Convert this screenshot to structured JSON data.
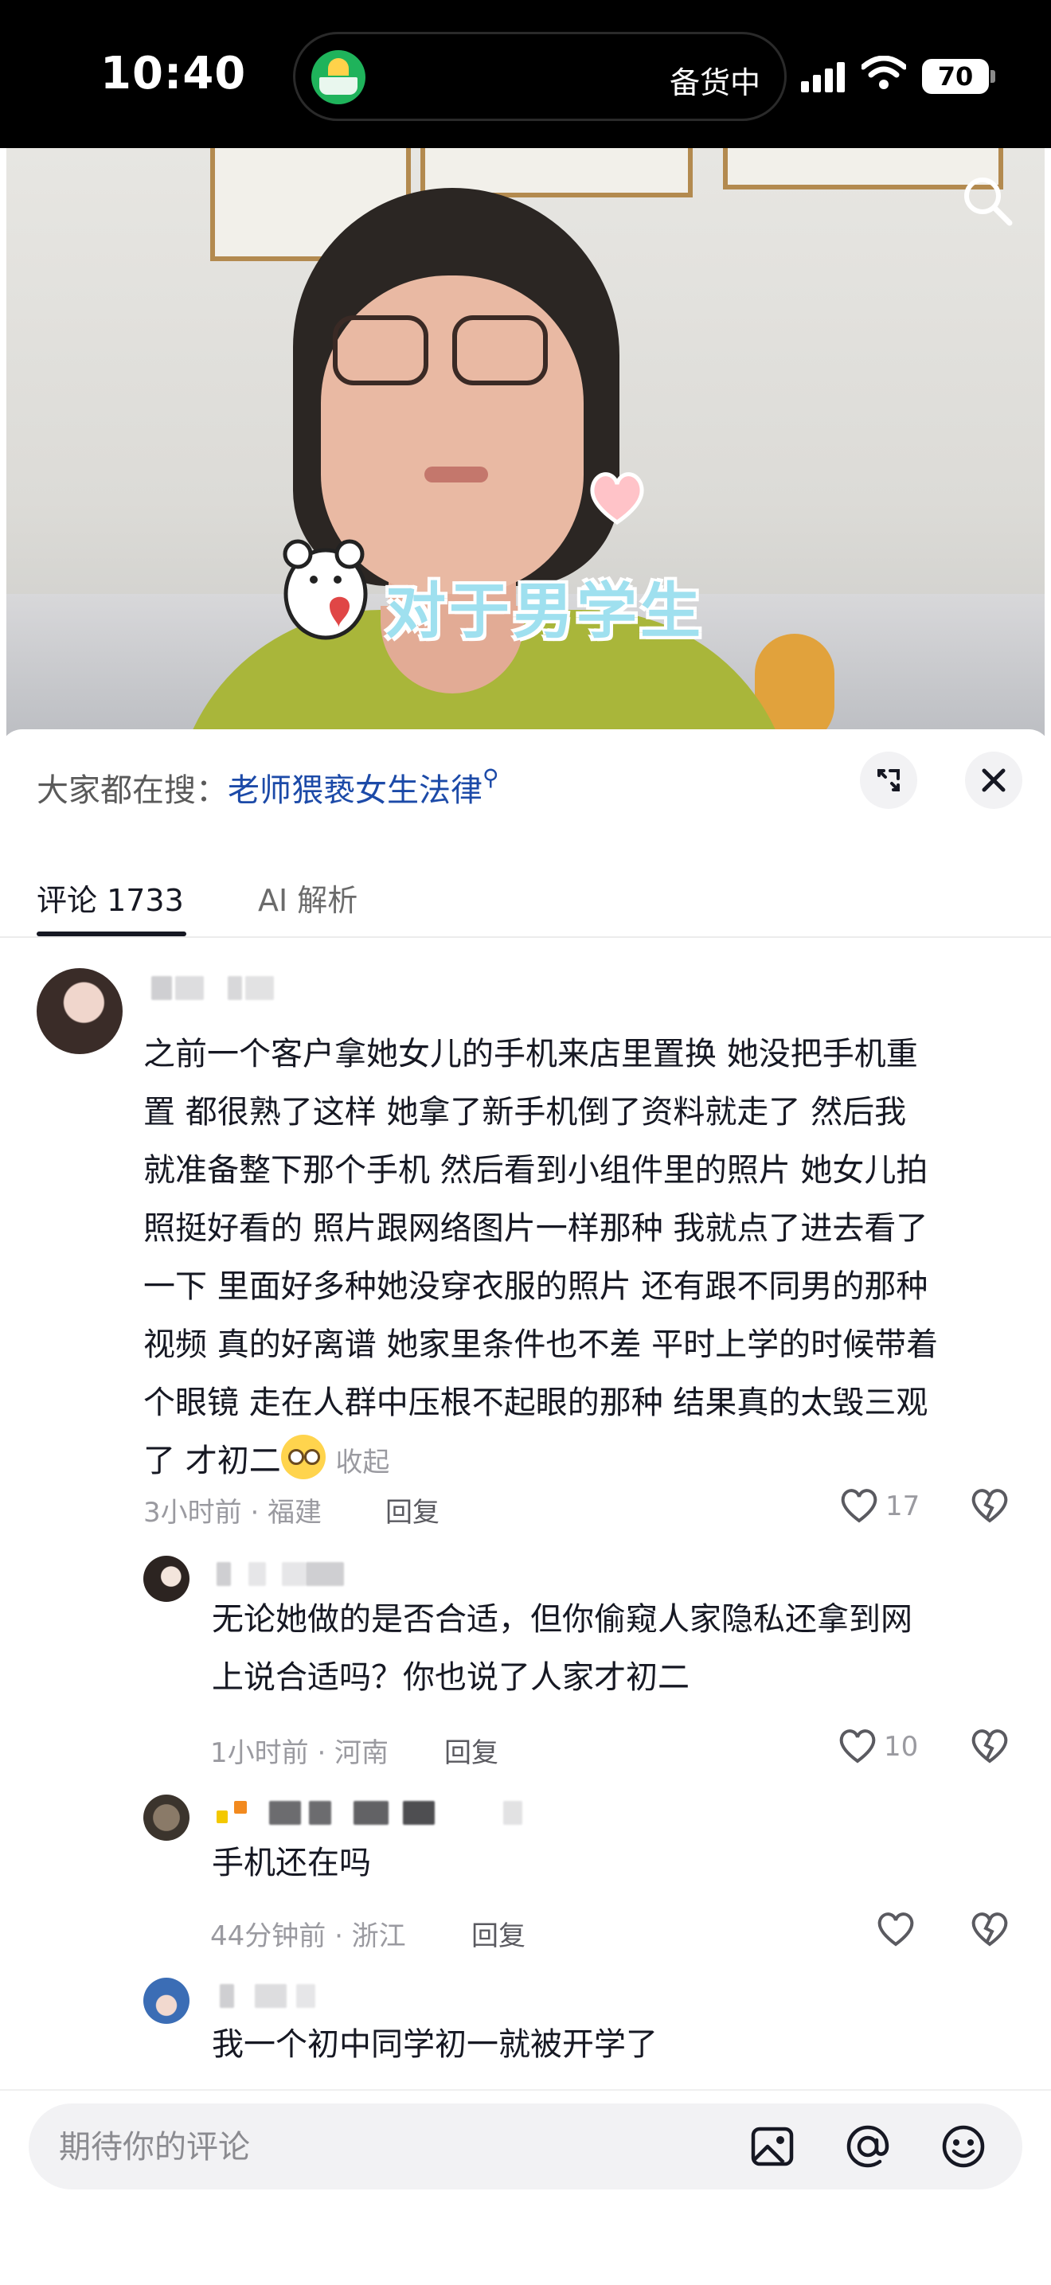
{
  "status_bar": {
    "time": "10:40",
    "island_text": "备货中",
    "battery": "70"
  },
  "video": {
    "sticker_text": "对于男学生"
  },
  "hot_search": {
    "prefix": "大家都在搜：",
    "keyword": "老师猥亵女生法律"
  },
  "tabs": [
    {
      "label": "评论 1733",
      "active": true
    },
    {
      "label": "AI 解析",
      "active": false
    }
  ],
  "comments": [
    {
      "lines": [
        "之前一个客户拿她女儿的手机来店里置换 她没把手机重",
        "置 都很熟了这样 她拿了新手机倒了资料就走了  然后我",
        "就准备整下那个手机 然后看到小组件里的照片 她女儿拍",
        "照挺好看的 照片跟网络图片一样那种 我就点了进去看了",
        "一下 里面好多种她没穿衣服的照片 还有跟不同男的那种",
        "视频 真的好离谱 她家里条件也不差 平时上学的时候带着",
        "个眼镜 走在人群中压根不起眼的那种 结果真的太毁三观",
        "了 才初二"
      ],
      "collapse": "收起",
      "meta": "3小时前 · 福建",
      "reply": "回复",
      "likes": "17"
    },
    {
      "lines": [
        "无论她做的是否合适，但你偷窥人家隐私还拿到网",
        "上说合适吗？你也说了人家才初二"
      ],
      "meta": "1小时前 · 河南",
      "reply": "回复",
      "likes": "10"
    },
    {
      "lines": [
        "手机还在吗"
      ],
      "meta": "44分钟前 · 浙江",
      "reply": "回复",
      "likes": ""
    },
    {
      "lines": [
        "我一个初中同学初一就被开学了"
      ]
    }
  ],
  "composer": {
    "placeholder": "期待你的评论"
  },
  "icons": [
    "search-icon",
    "expand-icon",
    "close-icon",
    "heart-icon",
    "dislike-icon",
    "image-icon",
    "at-icon",
    "emoji-icon"
  ]
}
